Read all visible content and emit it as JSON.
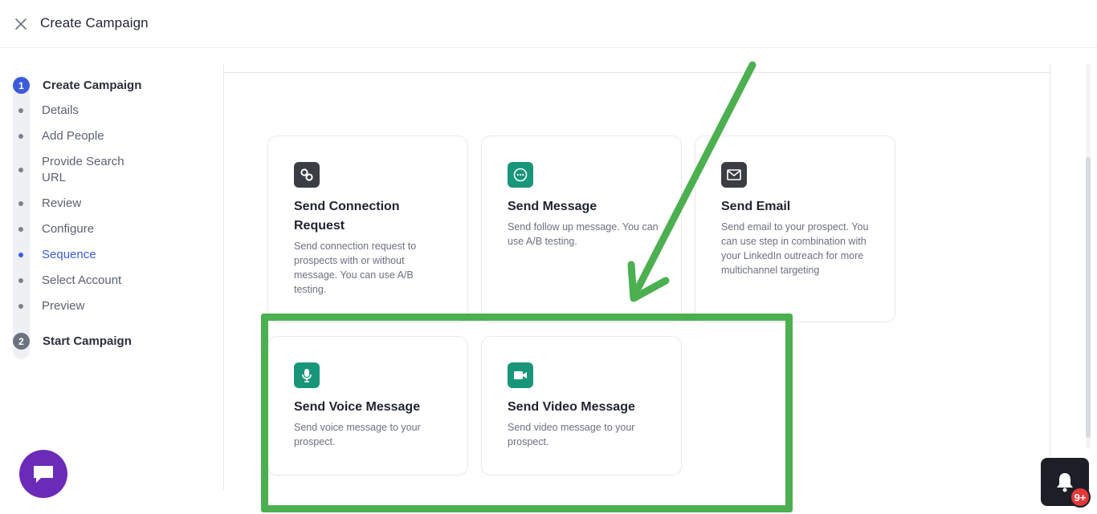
{
  "header": {
    "title": "Create Campaign"
  },
  "stepper": {
    "step1": {
      "number": "1",
      "label": "Create Campaign"
    },
    "substeps": [
      {
        "label": "Details"
      },
      {
        "label": "Add People"
      },
      {
        "label": "Provide Search URL"
      },
      {
        "label": "Review"
      },
      {
        "label": "Configure"
      },
      {
        "label": "Sequence"
      },
      {
        "label": "Select Account"
      },
      {
        "label": "Preview"
      }
    ],
    "active_substep": "Sequence",
    "step2": {
      "number": "2",
      "label": "Start Campaign"
    }
  },
  "cards": [
    {
      "title": "Send Connection Request",
      "desc": "Send connection request to prospects with or without message. You can use A/B testing.",
      "icon": "link-icon"
    },
    {
      "title": "Send Message",
      "desc": "Send follow up message. You can use A/B testing.",
      "icon": "chat-bubble-icon"
    },
    {
      "title": "Send Email",
      "desc": "Send email to your prospect. You can use step in combination with your LinkedIn outreach for more multichannel targeting",
      "icon": "envelope-icon"
    },
    {
      "title": "Send Voice Message",
      "desc": "Send voice message to your prospect.",
      "icon": "microphone-icon"
    },
    {
      "title": "Send Video Message",
      "desc": "Send video message to your prospect.",
      "icon": "video-camera-icon"
    }
  ],
  "notifications": {
    "badge": "9+"
  },
  "colors": {
    "accent": "#3b5bdb",
    "icon_dark": "#3a3d43",
    "icon_green": "#19967a",
    "annotation_green": "#4caf50",
    "chat_purple": "#6b2bb8",
    "badge_red": "#e5383b"
  }
}
